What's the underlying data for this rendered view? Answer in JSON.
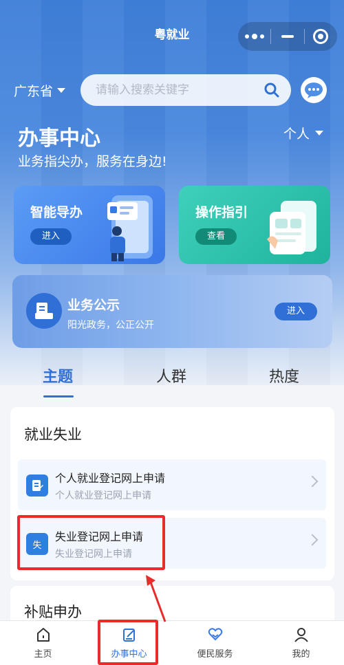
{
  "app": {
    "title": "粤就业"
  },
  "header": {
    "region": "广东省",
    "search_placeholder": "请输入搜索关键字"
  },
  "hero": {
    "title": "办事中心",
    "subtitle": "业务指尖办，服务在身边!",
    "persona": "个人"
  },
  "cards": [
    {
      "title": "智能导办",
      "button": "进入"
    },
    {
      "title": "操作指引",
      "button": "查看"
    }
  ],
  "notice": {
    "title": "业务公示",
    "subtitle": "阳光政务，公正公开",
    "button": "进入"
  },
  "tabs": [
    "主题",
    "人群",
    "热度"
  ],
  "sections": [
    {
      "title": "就业失业",
      "services": [
        {
          "title": "个人就业登记网上申请",
          "subtitle": "个人就业登记网上申请",
          "icon_char": ""
        },
        {
          "title": "失业登记网上申请",
          "subtitle": "失业登记网上申请",
          "icon_char": "失"
        }
      ]
    },
    {
      "title": "补贴申办"
    }
  ],
  "tabbar": [
    "主页",
    "办事中心",
    "便民服务",
    "我的"
  ],
  "colors": {
    "primary": "#2f6fd6",
    "highlight": "#e82c2c",
    "teal": "#1fb39c"
  }
}
